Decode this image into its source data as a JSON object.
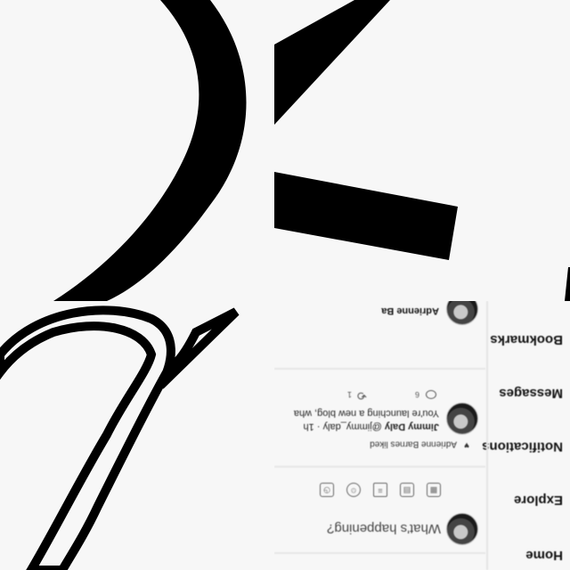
{
  "nav": {
    "items": [
      "Home",
      "Explore",
      "Notifications",
      "Messages",
      "Bookmarks"
    ]
  },
  "compose": {
    "placeholder": "What's happening?",
    "tools": [
      "image-icon",
      "gif-icon",
      "poll-icon",
      "emoji-icon",
      "schedule-icon"
    ]
  },
  "feed": {
    "social_context": "Adrienne Barnes liked",
    "tweet": {
      "author": "Jimmy Daly",
      "handle": "@jimmy_daly",
      "time": "1h",
      "text": "You're launching a new blog, wha",
      "reply_count": "6",
      "retweet_count": "1"
    },
    "next_author": "Adrienne Ba"
  },
  "colors": {
    "background": "#f7f7f7",
    "foreground": "#000000"
  }
}
